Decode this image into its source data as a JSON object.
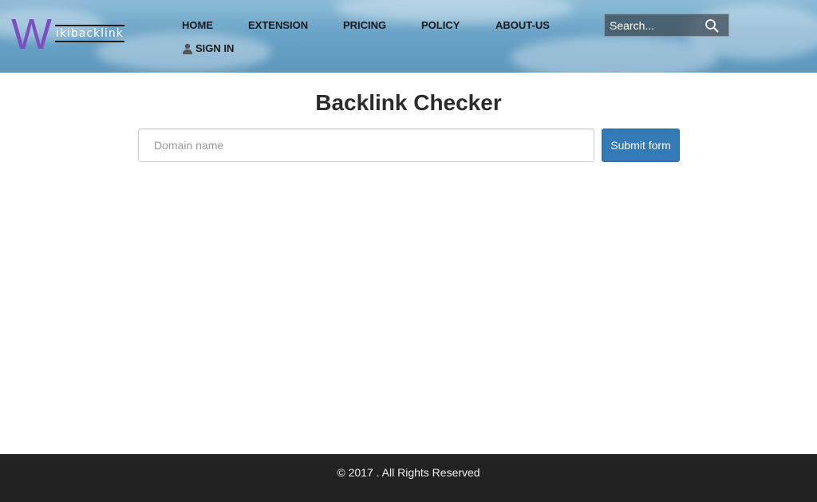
{
  "header": {
    "logo": {
      "letter": "W",
      "word": "ikibacklink"
    },
    "nav": [
      {
        "label": "HOME"
      },
      {
        "label": "EXTENSION"
      },
      {
        "label": "PRICING"
      },
      {
        "label": "POLICY"
      },
      {
        "label": "ABOUT-US"
      }
    ],
    "signin": {
      "label": "SIGN IN",
      "icon": "user-icon"
    },
    "search": {
      "placeholder": "Search...",
      "icon": "search-icon"
    }
  },
  "main": {
    "title": "Backlink Checker",
    "domain_input": {
      "placeholder": "Domain name",
      "value": ""
    },
    "submit_label": "Submit form"
  },
  "footer": {
    "copyright": "© 2017 . All Rights Reserved"
  },
  "colors": {
    "logo_accent": "#7b4fbf",
    "primary_button": "#337ab7",
    "footer_bg": "#222222",
    "title_text": "#2b2b2b"
  }
}
